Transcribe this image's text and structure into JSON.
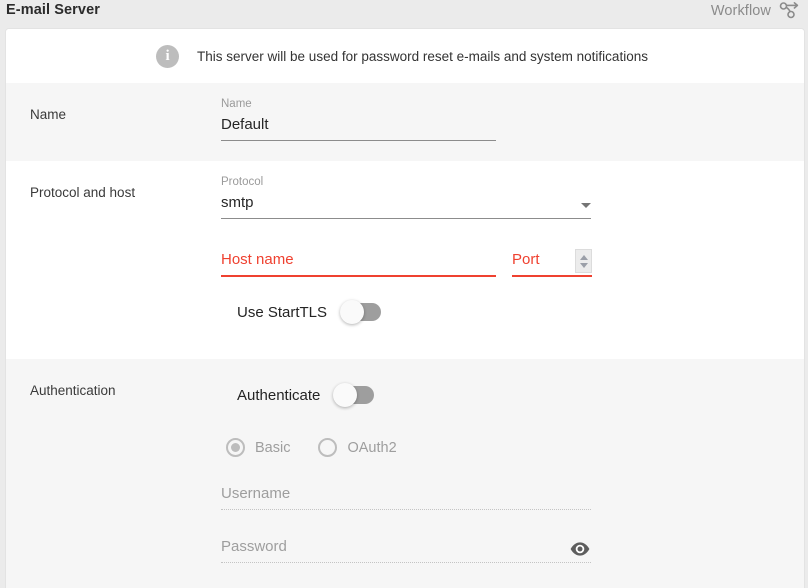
{
  "header": {
    "title": "E-mail Server",
    "workflow_label": "Workflow",
    "workflow_icon": "workflow-branch-icon"
  },
  "info_banner": {
    "icon": "info-icon",
    "text": "This server will be used for password reset e-mails and system notifications"
  },
  "sections": {
    "name": {
      "section_label": "Name",
      "field_label": "Name",
      "field_value": "Default"
    },
    "protocol_and_host": {
      "section_label": "Protocol and host",
      "protocol": {
        "field_label": "Protocol",
        "value": "smtp",
        "dropdown_icon": "chevron-down-icon"
      },
      "host_name": {
        "placeholder": "Host name",
        "value": "",
        "state": "error"
      },
      "port": {
        "placeholder": "Port",
        "value": "",
        "state": "error",
        "spinner_icon": "number-spinner-icon"
      },
      "start_tls": {
        "label": "Use StartTLS",
        "state": "off"
      }
    },
    "authentication": {
      "section_label": "Authentication",
      "authenticate": {
        "label": "Authenticate",
        "state": "off"
      },
      "method_options": [
        {
          "label": "Basic",
          "selected": true,
          "disabled": true
        },
        {
          "label": "OAuth2",
          "selected": false,
          "disabled": true
        }
      ],
      "username": {
        "placeholder": "Username",
        "value": "",
        "disabled": true
      },
      "password": {
        "placeholder": "Password",
        "value": "",
        "disabled": true,
        "reveal_icon": "eye-icon"
      }
    }
  },
  "colors": {
    "error": "#ef4130",
    "page_background": "#ebebeb",
    "section_shaded": "#f6f6f6",
    "muted_text": "#9e9e9e"
  }
}
